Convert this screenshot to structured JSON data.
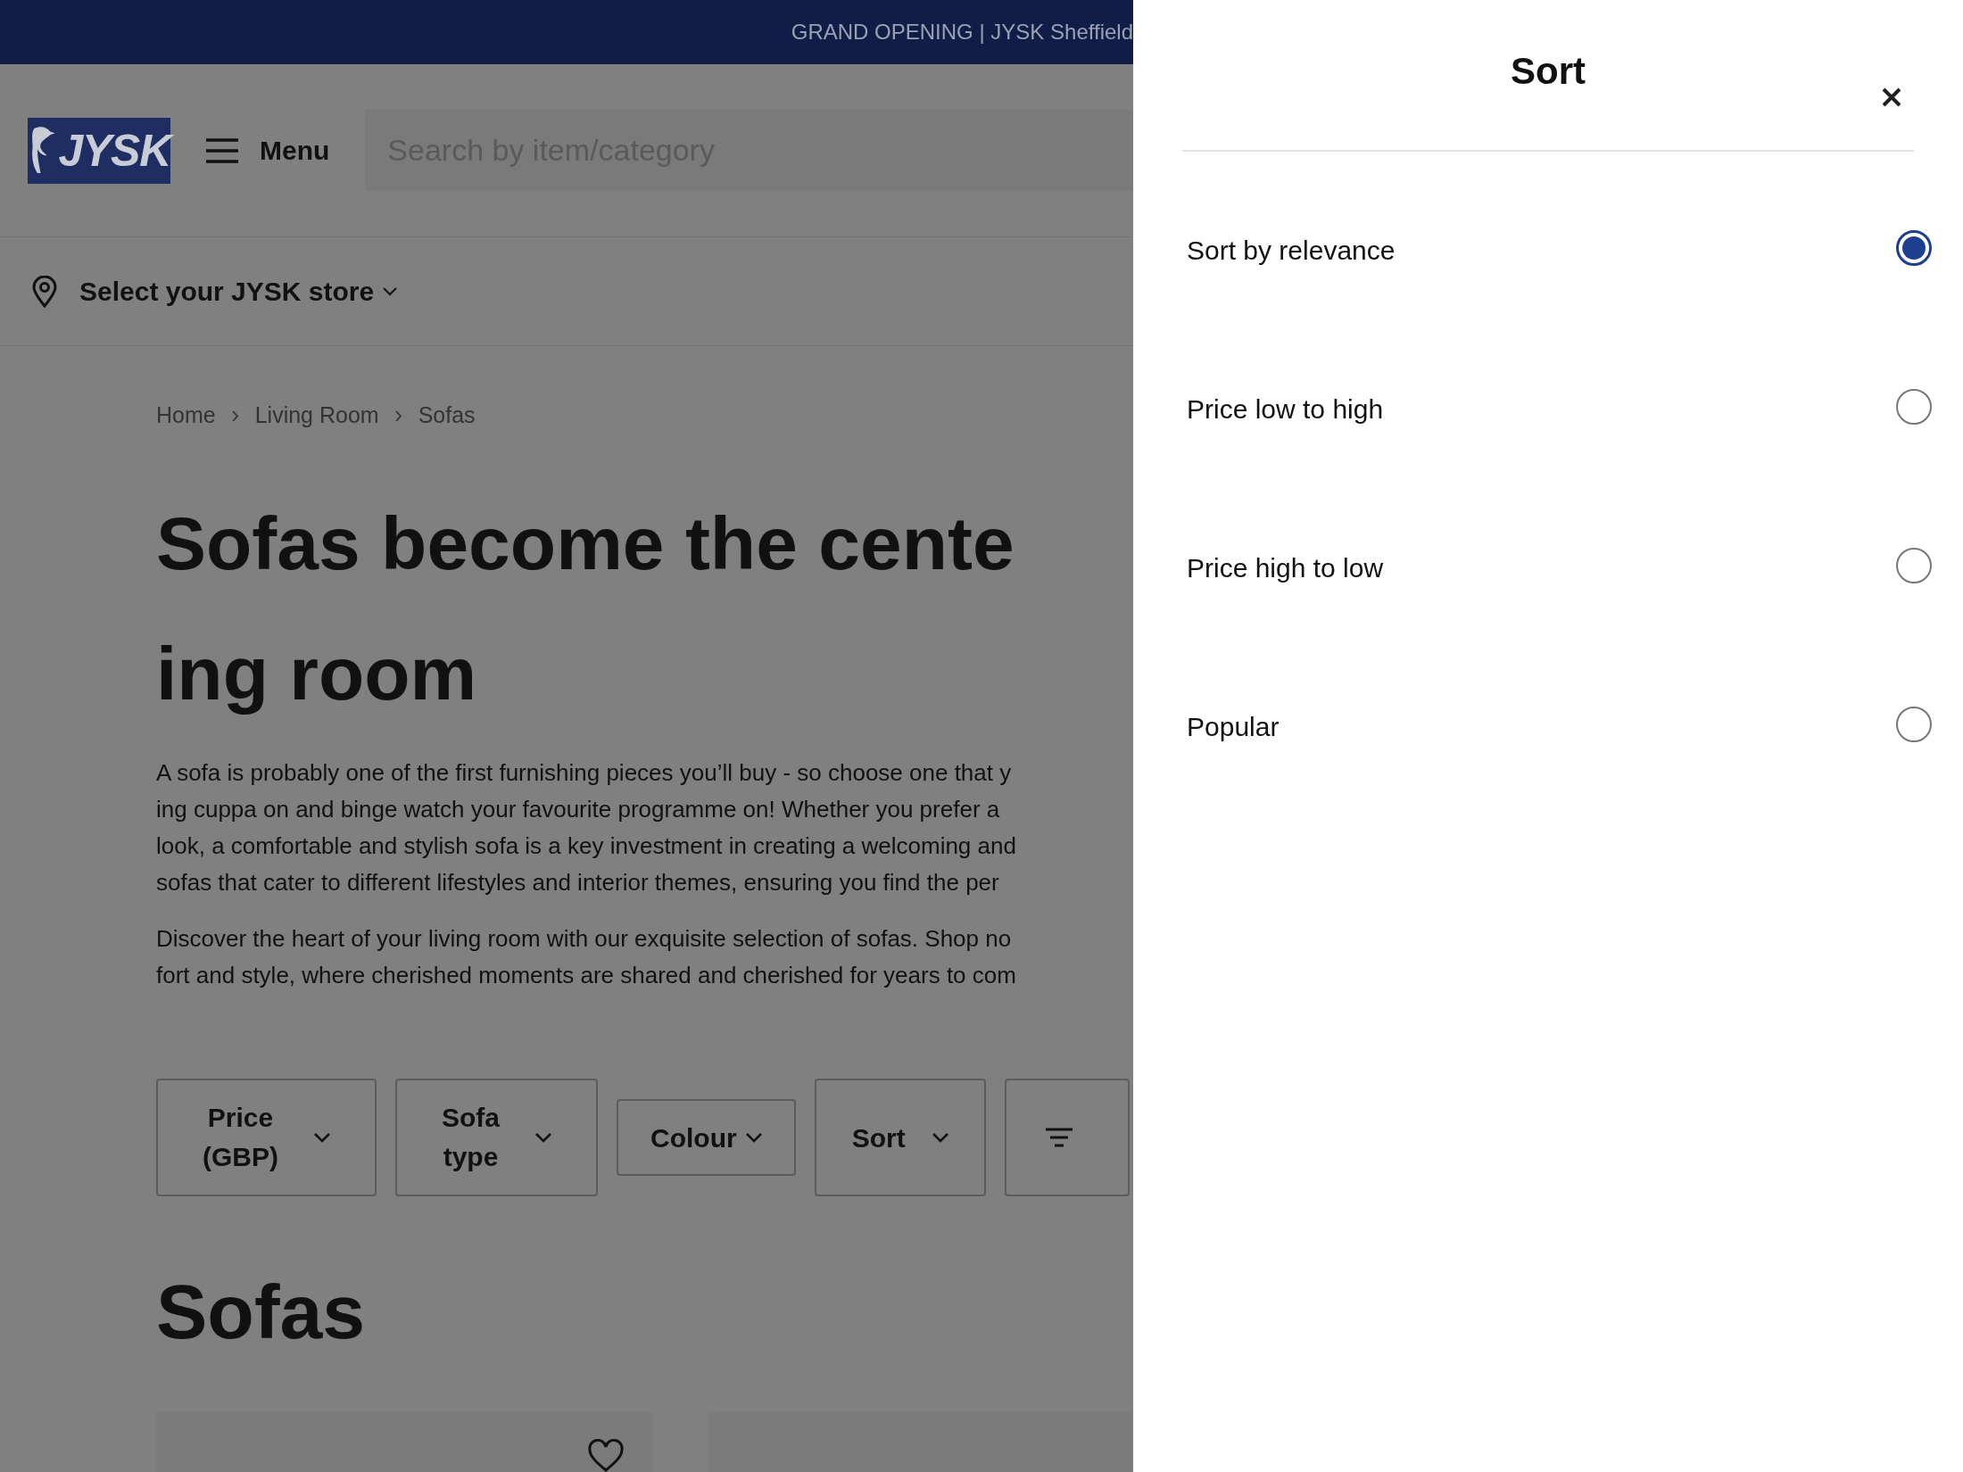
{
  "top_banner": {
    "text": "GRAND OPENING | JYSK Sheffield"
  },
  "header": {
    "logo_text": "JYSK",
    "menu_label": "Menu",
    "search": {
      "placeholder": "Search by item/category"
    }
  },
  "store_selector": {
    "label": "Select your JYSK store"
  },
  "breadcrumb": [
    {
      "label": "Home"
    },
    {
      "label": "Living Room"
    },
    {
      "label": "Sofas"
    }
  ],
  "heading_lines": [
    "Sofas become the cente",
    "ing room"
  ],
  "paragraphs": [
    [
      "A sofa is probably one of the first furnishing pieces you’ll buy - so choose one that y",
      "ing cuppa on and binge watch your favourite programme on! Whether you prefer a",
      "look, a comfortable and stylish sofa is a key investment in creating a welcoming and",
      "sofas that cater to different lifestyles and interior themes, ensuring you find the per"
    ],
    [
      "Discover the heart of your living room with our exquisite selection of sofas. Shop no",
      "fort and style, where cherished moments are shared and cherished for years to com"
    ]
  ],
  "filters": [
    {
      "kind": "dropdown",
      "label_lines": [
        "Price",
        "(GBP)"
      ]
    },
    {
      "kind": "dropdown",
      "label_lines": [
        "Sofa",
        "type"
      ]
    },
    {
      "kind": "dropdown",
      "label_lines": [
        "Colour"
      ]
    },
    {
      "kind": "dropdown",
      "label_lines": [
        "Sort"
      ]
    },
    {
      "kind": "more"
    }
  ],
  "section_title": "Sofas",
  "sort_panel": {
    "title": "Sort",
    "options": [
      {
        "label": "Sort by relevance",
        "selected": true
      },
      {
        "label": "Price low to high",
        "selected": false
      },
      {
        "label": "Price high to low",
        "selected": false
      },
      {
        "label": "Popular",
        "selected": false
      }
    ]
  }
}
